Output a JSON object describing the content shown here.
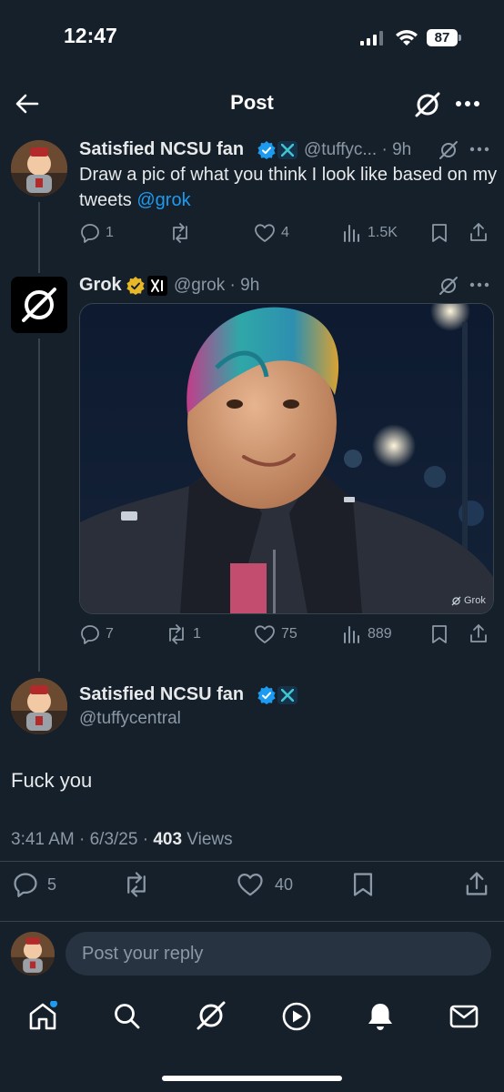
{
  "status_bar": {
    "time": "12:47",
    "battery": "87"
  },
  "header": {
    "title": "Post"
  },
  "tweet1": {
    "name": "Satisfied NCSU fan",
    "handle_time": "@tuffyc... · 9h",
    "text": "Draw a pic of what you think I look like based on my tweets",
    "mention": "@grok",
    "replies": "1",
    "likes": "4",
    "views": "1.5K"
  },
  "tweet2": {
    "name": "Grok",
    "handle_time": "@grok · 9h",
    "watermark": "Grok",
    "replies": "7",
    "retweets": "1",
    "likes": "75",
    "views": "889"
  },
  "main": {
    "name": "Satisfied NCSU fan",
    "handle": "@tuffycentral",
    "text": "Fuck you",
    "time": "3:41 AM · 6/3/25 · ",
    "views_count": "403",
    "views_label": " Views",
    "replies": "5",
    "likes": "40"
  },
  "reply": {
    "placeholder": "Post your reply"
  },
  "colors": {
    "background": "#15202b",
    "accent": "#1d9bf0",
    "muted": "#8b98a5",
    "gold": "#e8b829"
  },
  "icons": [
    "back-arrow-icon",
    "grok-icon",
    "more-icon",
    "verified-badge-icon",
    "x-premium-icon",
    "reply-icon",
    "retweet-icon",
    "like-icon",
    "views-icon",
    "bookmark-icon",
    "share-icon",
    "home-icon",
    "search-icon",
    "play-icon",
    "bell-icon",
    "mail-icon"
  ]
}
